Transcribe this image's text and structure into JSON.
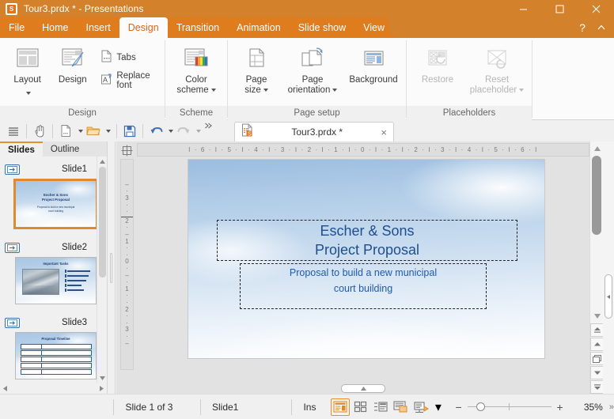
{
  "window": {
    "title": "Tour3.prdx * - Presentations",
    "app_icon": "presentation-app-icon",
    "logo_letter": "S",
    "minimize_label": "Minimize",
    "maximize_label": "Maximize",
    "close_label": "Close"
  },
  "ribbon": {
    "tabs": [
      {
        "label": "File",
        "active": false
      },
      {
        "label": "Home",
        "active": false
      },
      {
        "label": "Insert",
        "active": false
      },
      {
        "label": "Design",
        "active": true
      },
      {
        "label": "Transition",
        "active": false
      },
      {
        "label": "Animation",
        "active": false
      },
      {
        "label": "Slide show",
        "active": false
      },
      {
        "label": "View",
        "active": false
      }
    ],
    "help_label": "?",
    "collapse_label": "^",
    "groups": [
      {
        "name": "Design",
        "label": "Design",
        "buttons": [
          {
            "label": "Layout",
            "icon": "layout-icon",
            "dropdown": true,
            "enabled": true
          },
          {
            "label": "Design",
            "icon": "design-brush-icon",
            "dropdown": false,
            "enabled": true
          }
        ],
        "small_buttons": [
          {
            "label": "Tabs",
            "icon": "tabs-icon",
            "enabled": true
          },
          {
            "label": "Replace font",
            "icon": "replace-font-icon",
            "enabled": true
          }
        ]
      },
      {
        "name": "Scheme",
        "label": "Scheme",
        "buttons": [
          {
            "label": "Color\nscheme",
            "label_line1": "Color",
            "label_line2": "scheme",
            "icon": "color-scheme-icon",
            "dropdown": true,
            "enabled": true
          }
        ]
      },
      {
        "name": "Page setup",
        "label": "Page setup",
        "buttons": [
          {
            "label_line1": "Page",
            "label_line2": "size",
            "icon": "page-size-icon",
            "dropdown": true,
            "enabled": true
          },
          {
            "label_line1": "Page",
            "label_line2": "orientation",
            "icon": "page-orientation-icon",
            "dropdown": true,
            "enabled": true
          },
          {
            "label_line1": "Background",
            "label_line2": "",
            "icon": "background-icon",
            "dropdown": false,
            "enabled": true
          }
        ]
      },
      {
        "name": "Placeholders",
        "label": "Placeholders",
        "buttons": [
          {
            "label_line1": "Restore",
            "label_line2": "",
            "icon": "restore-placeholder-icon",
            "dropdown": false,
            "enabled": false
          },
          {
            "label_line1": "Reset",
            "label_line2": "placeholder",
            "icon": "reset-placeholder-icon",
            "dropdown": true,
            "enabled": false
          }
        ]
      }
    ]
  },
  "quick_access": {
    "buttons": [
      {
        "name": "menu-icon",
        "label": "Menu"
      },
      {
        "name": "hand-select-icon",
        "label": "Select"
      },
      {
        "name": "new-document-icon",
        "label": "New"
      },
      {
        "name": "new-dropdown-caret",
        "label": "New options"
      },
      {
        "name": "open-folder-icon",
        "label": "Open"
      },
      {
        "name": "open-dropdown-caret",
        "label": "Open options"
      },
      {
        "name": "save-icon",
        "label": "Save"
      },
      {
        "name": "undo-icon",
        "label": "Undo"
      },
      {
        "name": "undo-dropdown-caret",
        "label": "Undo history"
      },
      {
        "name": "redo-icon",
        "label": "Redo"
      },
      {
        "name": "redo-dropdown-caret",
        "label": "Redo history"
      },
      {
        "name": "overflow-chevrons",
        "label": "More"
      }
    ]
  },
  "document_tab": {
    "title": "Tour3.prdx *",
    "icon": "presentation-file-icon",
    "close_label": "×"
  },
  "panel": {
    "tabs": [
      {
        "label": "Slides",
        "active": true
      },
      {
        "label": "Outline",
        "active": false
      }
    ],
    "slides": [
      {
        "number_label": "Slide1",
        "selected": true,
        "type": "title-slide",
        "title_lines": [
          "Escher & Sons",
          "Project Proposal"
        ],
        "subtitle_lines": [
          "Proposal to build a new municipal",
          "court building"
        ]
      },
      {
        "number_label": "Slide2",
        "selected": false,
        "type": "picture-bullets-slide",
        "heading": "Important Tasks",
        "bullets": [
          "Building code info",
          "Zoning code info",
          "Cost estimating",
          "Permitting",
          "Builder filings"
        ]
      },
      {
        "number_label": "Slide3",
        "selected": false,
        "type": "table-slide",
        "heading": "Proposal Timeline",
        "rows": 5
      }
    ]
  },
  "editor": {
    "horizontal_ruler": "I · 6 · I · 5 · I · 4 · I · 3 · I · 2 · I · 1 · I · 0 · I · 1 · I · 2 · I · 3 · I · 4 · I · 5 · I · 6 · I",
    "vertical_ruler_marks": [
      "–",
      "·",
      "3",
      "·",
      "·",
      "2",
      "·",
      "–",
      "1",
      "·",
      "·",
      "0",
      "·",
      "–",
      "·",
      "1",
      "·",
      "·",
      "2",
      "·",
      "·",
      "3",
      "·",
      "–"
    ],
    "slide": {
      "title_line1": "Escher & Sons",
      "title_line2": "Project Proposal",
      "subtitle_line1": "Proposal to build a new municipal",
      "subtitle_line2": "court building",
      "title_color": "#1f4e8c",
      "subtitle_color": "#1f5bab"
    }
  },
  "status_bar": {
    "slide_counter": "Slide 1 of 3",
    "layout_name": "Slide1",
    "insert_mode": "Ins",
    "view_buttons": [
      {
        "name": "normal-view-icon",
        "label": "Normal view",
        "selected": true
      },
      {
        "name": "slide-sorter-icon",
        "label": "Slide sorter",
        "selected": false
      },
      {
        "name": "outline-view-icon",
        "label": "Outline view",
        "selected": false
      },
      {
        "name": "notes-view-icon",
        "label": "Notes view",
        "selected": false
      },
      {
        "name": "slideshow-icon",
        "label": "Start slideshow",
        "selected": false
      }
    ],
    "slideshow_caret": "▾",
    "zoom_out": "−",
    "zoom_in": "+",
    "zoom_value": "35%",
    "fit_label": "»"
  },
  "colors": {
    "title_bar": "#d3812a",
    "tab_strip_active_bg": "#de7c1e",
    "accent_orange": "#e2912f",
    "ribbon_bg": "#fbfbfb",
    "panel_bg": "#f0f0f0",
    "canvas_bg": "#e2e2e2",
    "slide_title": "#1f4e8c"
  }
}
